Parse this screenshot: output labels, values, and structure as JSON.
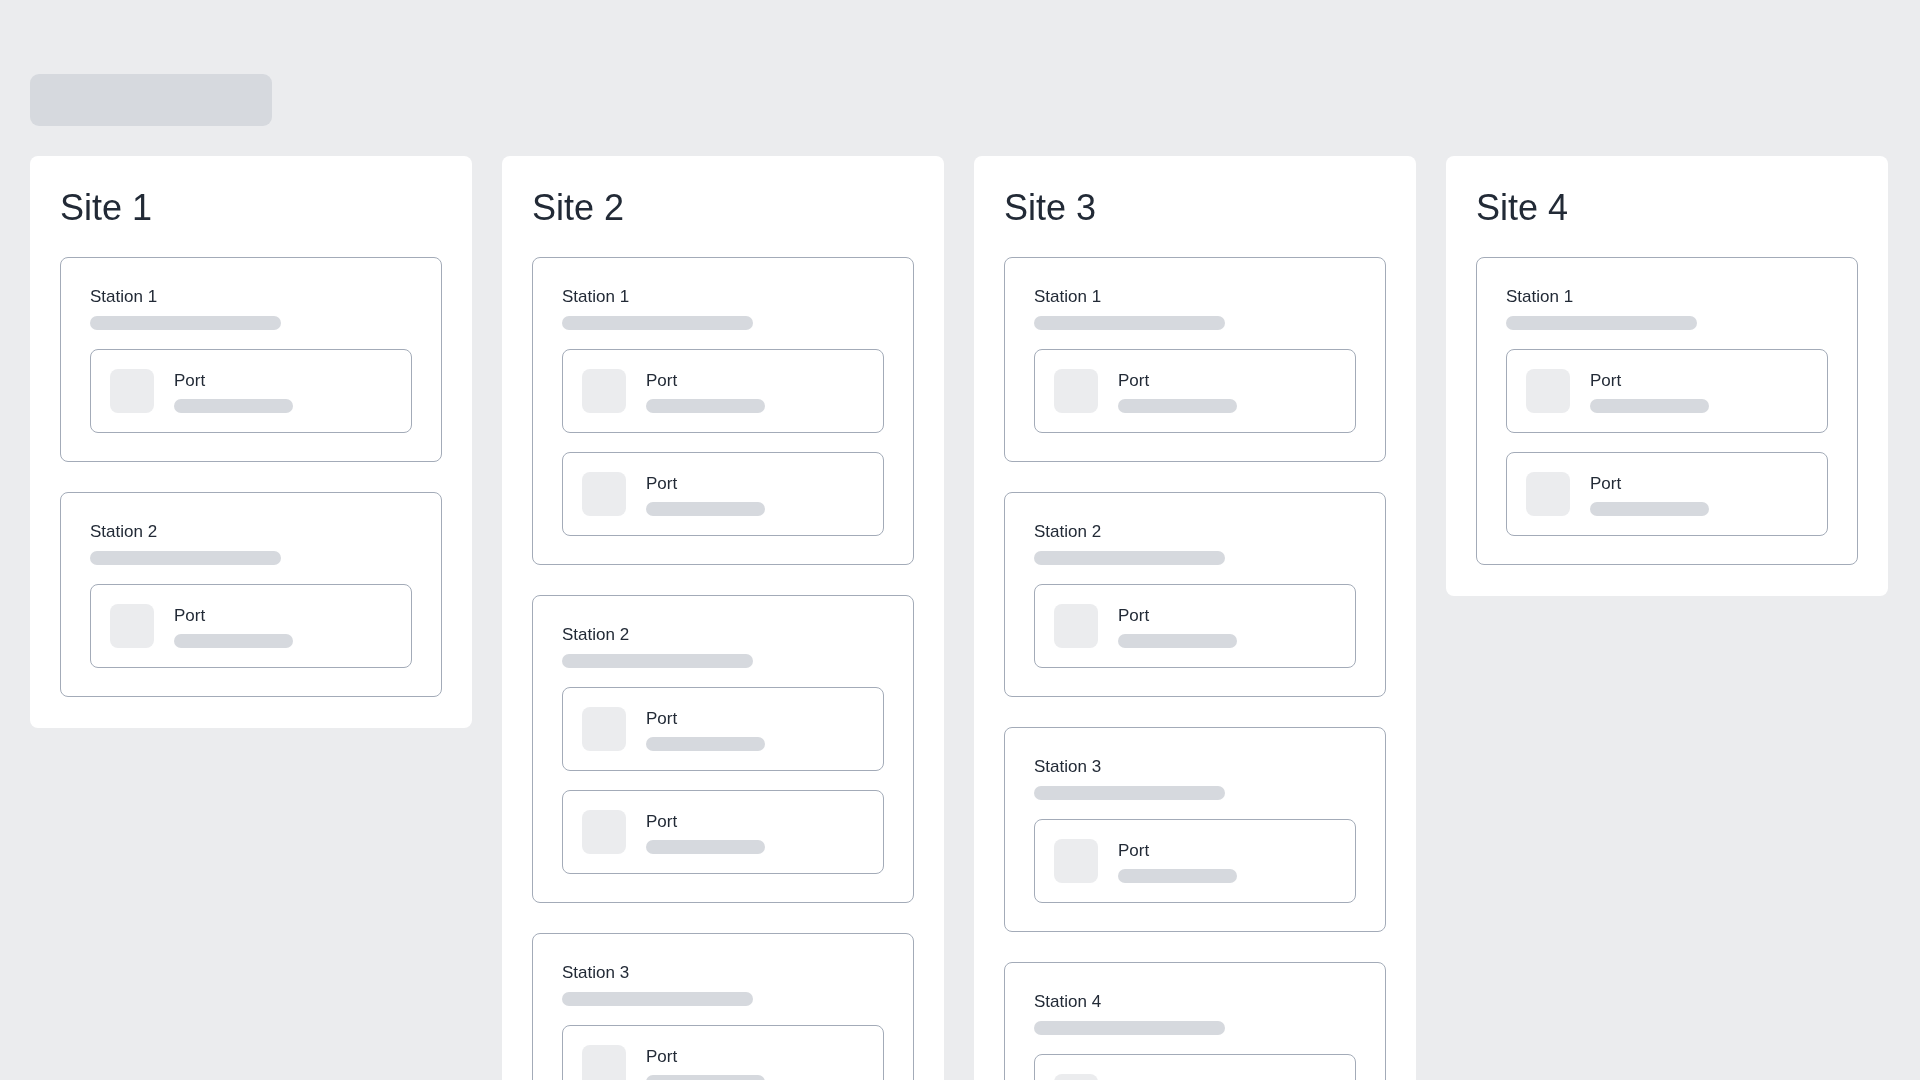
{
  "sites": [
    {
      "title": "Site 1",
      "stations": [
        {
          "name": "Station 1",
          "ports": [
            {
              "kind": "port",
              "label": "Port"
            }
          ]
        },
        {
          "name": "Station 2",
          "ports": [
            {
              "kind": "port",
              "label": "Port"
            }
          ]
        }
      ]
    },
    {
      "title": "Site 2",
      "stations": [
        {
          "name": "Station 1",
          "ports": [
            {
              "kind": "port",
              "label": "Port"
            },
            {
              "kind": "port",
              "label": "Port"
            }
          ]
        },
        {
          "name": "Station 2",
          "ports": [
            {
              "kind": "port",
              "label": "Port"
            },
            {
              "kind": "port",
              "label": "Port"
            }
          ]
        },
        {
          "name": "Station 3",
          "ports": [
            {
              "kind": "port",
              "label": "Port"
            }
          ]
        }
      ]
    },
    {
      "title": "Site 3",
      "stations": [
        {
          "name": "Station 1",
          "ports": [
            {
              "kind": "port",
              "label": "Port"
            }
          ]
        },
        {
          "name": "Station 2",
          "ports": [
            {
              "kind": "port",
              "label": "Port"
            }
          ]
        },
        {
          "name": "Station 3",
          "ports": [
            {
              "kind": "port",
              "label": "Port"
            }
          ]
        },
        {
          "name": "Station 4",
          "ports": [
            {
              "kind": "port"
            }
          ]
        }
      ]
    },
    {
      "title": "Site 4",
      "stations": [
        {
          "name": "Station 1",
          "ports": [
            {
              "kind": "port",
              "label": "Port"
            },
            {
              "kind": "port",
              "label": "Port"
            }
          ]
        }
      ]
    }
  ]
}
